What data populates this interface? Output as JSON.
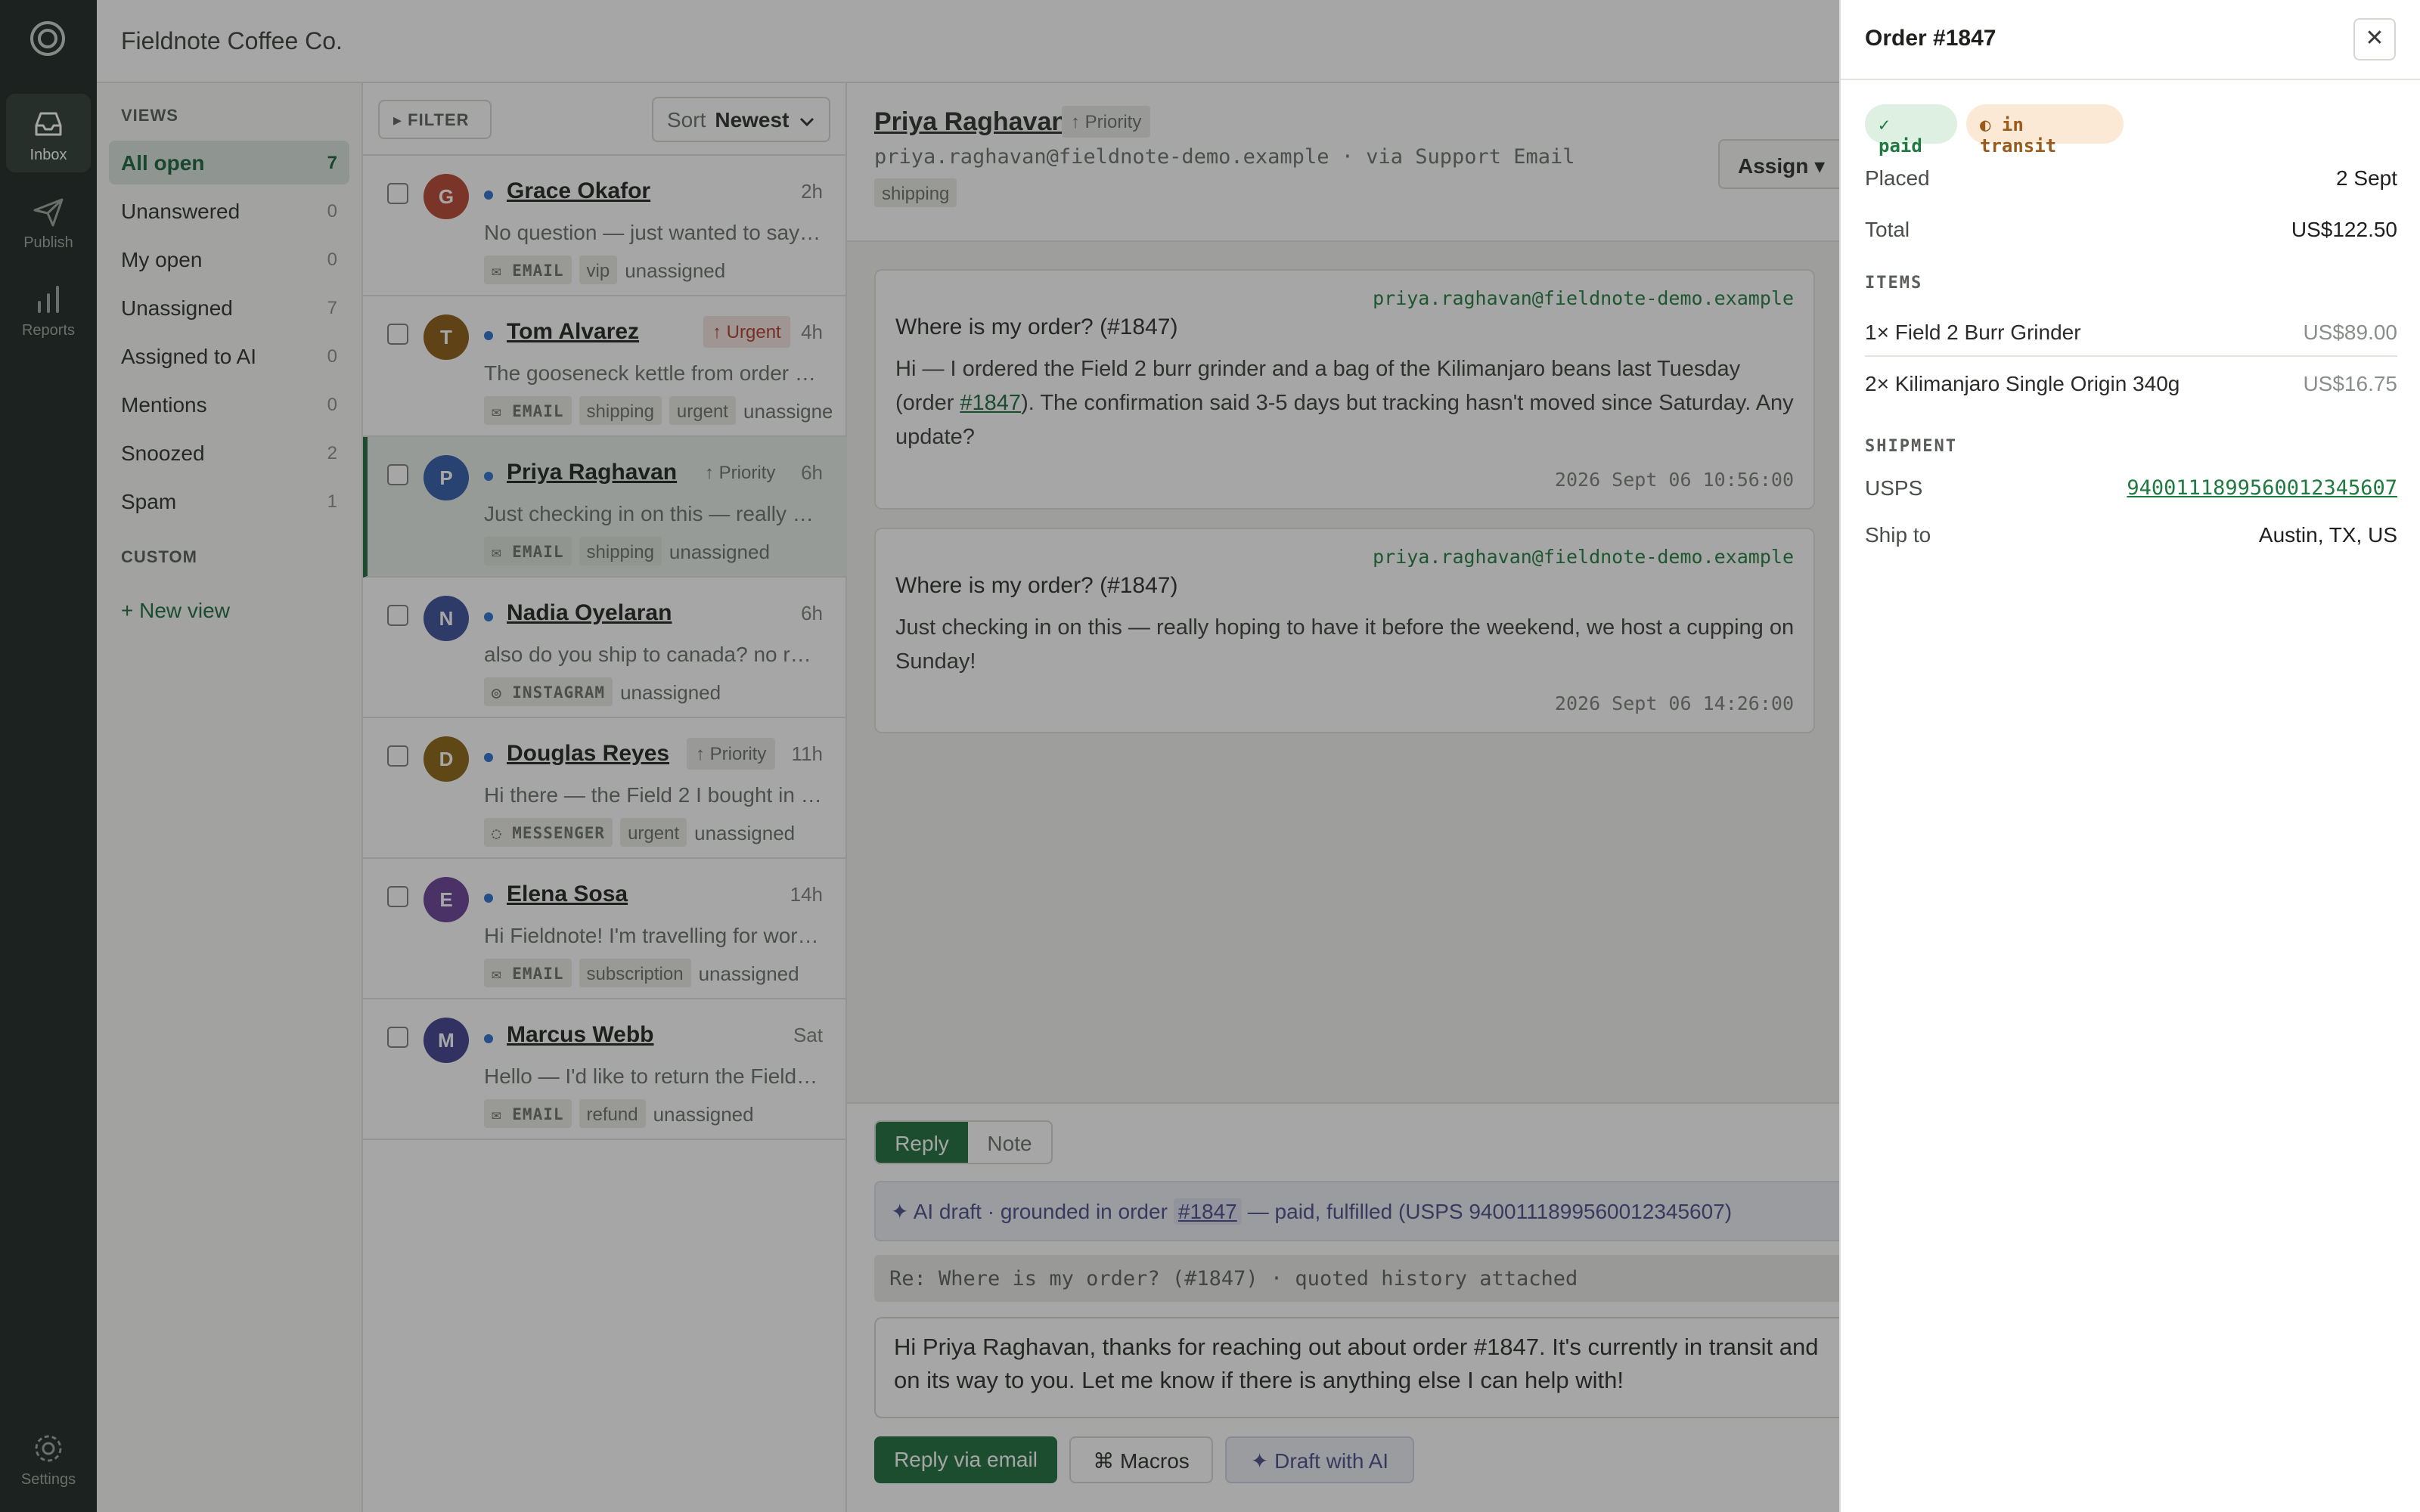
{
  "rail": {
    "items": [
      {
        "label": "Inbox",
        "icon": "inbox-icon"
      },
      {
        "label": "Publish",
        "icon": "send-icon"
      },
      {
        "label": "Reports",
        "icon": "bar-chart-icon"
      },
      {
        "label": "Settings",
        "icon": "gear-icon"
      }
    ]
  },
  "header": {
    "brand": "Fieldnote Coffee Co."
  },
  "views": {
    "title": "VIEWS",
    "items": [
      {
        "label": "All open",
        "count": "7"
      },
      {
        "label": "Unanswered",
        "count": "0"
      },
      {
        "label": "My open",
        "count": "0"
      },
      {
        "label": "Unassigned",
        "count": "7"
      },
      {
        "label": "Assigned to AI",
        "count": "0"
      },
      {
        "label": "Mentions",
        "count": "0"
      },
      {
        "label": "Snoozed",
        "count": "2"
      },
      {
        "label": "Spam",
        "count": "1"
      }
    ],
    "custom_title": "CUSTOM",
    "new_view": "+ New view"
  },
  "list": {
    "filter_label": "▸ FILTER",
    "sort_label": "Sort",
    "sort_value": "Newest",
    "conversations": [
      {
        "initial": "G",
        "name": "Grace Okafor",
        "time": "2h",
        "tag": "",
        "preview": "No question — just wanted to say the Kilimanjaro beans are amazing",
        "channel": "✉ EMAIL",
        "labels": [
          "vip"
        ],
        "assignee": "unassigned"
      },
      {
        "initial": "T",
        "name": "Tom Alvarez",
        "time": "4h",
        "tag": "↑ Urgent",
        "preview": "The gooseneck kettle from order arrived dented on one side",
        "channel": "✉ EMAIL",
        "labels": [
          "shipping",
          "urgent"
        ],
        "assignee": "unassigned"
      },
      {
        "initial": "P",
        "name": "Priya Raghavan",
        "time": "6h",
        "tag": "↑ Priority",
        "preview": "Just checking in on this — really hoping to have it before the weekend",
        "channel": "✉ EMAIL",
        "labels": [
          "shipping"
        ],
        "assignee": "unassigned"
      },
      {
        "initial": "N",
        "name": "Nadia Oyelaran",
        "time": "6h",
        "tag": "",
        "preview": "also do you ship to canada? no rush",
        "channel": "◎ INSTAGRAM",
        "labels": [],
        "assignee": "unassigned"
      },
      {
        "initial": "D",
        "name": "Douglas Reyes",
        "time": "11h",
        "tag": "↑ Priority",
        "preview": "Hi there — the Field 2 I bought in June stopped grinding evenly",
        "channel": "◌ MESSENGER",
        "labels": [
          "urgent"
        ],
        "assignee": "unassigned"
      },
      {
        "initial": "E",
        "name": "Elena Sosa",
        "time": "14h",
        "tag": "",
        "preview": "Hi Fieldnote! I'm travelling for work next month, can I pause",
        "channel": "✉ EMAIL",
        "labels": [
          "subscription"
        ],
        "assignee": "unassigned"
      },
      {
        "initial": "M",
        "name": "Marcus Webb",
        "time": "Sat",
        "tag": "",
        "preview": "Hello — I'd like to return the Field 2 burr grinder, unopened",
        "channel": "✉ EMAIL",
        "labels": [
          "refund"
        ],
        "assignee": "unassigned"
      }
    ]
  },
  "conversation": {
    "name": "Priya Raghavan",
    "priority": "↑ Priority",
    "subline": "priya.raghavan@fieldnote-demo.example · via Support Email",
    "tag": "shipping",
    "assign_label": "Assign ▾",
    "messages": [
      {
        "from": "priya.raghavan@fieldnote-demo.example",
        "subject": "Where is my order? (#1847)",
        "body_before": "Hi — I ordered the Field 2 burr grinder and a bag of the Kilimanjaro beans last Tuesday (order ",
        "body_link": "#1847",
        "body_after": "). The confirmation said 3-5 days but tracking hasn't moved since Saturday. Any update?",
        "timestamp": "2026 Sept 06 10:56:00"
      },
      {
        "from": "priya.raghavan@fieldnote-demo.example",
        "subject": "Where is my order? (#1847)",
        "body_before": "Just checking in on this — really hoping to have it before the weekend, we host a cupping on Sunday!",
        "body_link": "",
        "body_after": "",
        "timestamp": "2026 Sept 06 14:26:00"
      }
    ]
  },
  "composer": {
    "tab_reply": "Reply",
    "tab_note": "Note",
    "ai_prefix": "✦  AI draft · grounded in order",
    "ai_token": "#1847",
    "ai_suffix": "— paid, fulfilled (USPS 9400111899560012345607)",
    "quoted": "Re: Where is my order? (#1847) · quoted history attached",
    "draft_text": "Hi Priya Raghavan, thanks for reaching out about order #1847. It's currently in transit and on its way to you. Let me know if there is anything else I can help with!",
    "send_label": "Reply via email",
    "macros_label": "⌘  Macros",
    "draft_ai_label": "✦  Draft with AI"
  },
  "order": {
    "title": "Order #1847",
    "close": "✕",
    "badge_paid": "✓ paid",
    "badge_transit": "◐ in transit",
    "placed_label": "Placed",
    "placed_value": "2 Sept",
    "total_label": "Total",
    "total_value": "US$122.50",
    "items_title": "ITEMS",
    "items": [
      {
        "name": "1× Field 2 Burr Grinder",
        "price": "US$89.00"
      },
      {
        "name": "2× Kilimanjaro Single Origin 340g",
        "price": "US$16.75"
      }
    ],
    "shipment_title": "SHIPMENT",
    "carrier_label": "USPS",
    "tracking": "9400111899560012345607",
    "shipto_label": "Ship to",
    "shipto_value": "Austin, TX, US"
  },
  "colors": {
    "accent": "#1c6b3b",
    "rail_bg": "#1a2420",
    "avatar_g": "#b8412f",
    "avatar_t": "#8a5a12",
    "avatar_p": "#2f5aa8",
    "avatar_n": "#3a4d9a",
    "avatar_d": "#8a6212",
    "avatar_e": "#6a3f96",
    "avatar_m": "#3e3f8e"
  }
}
